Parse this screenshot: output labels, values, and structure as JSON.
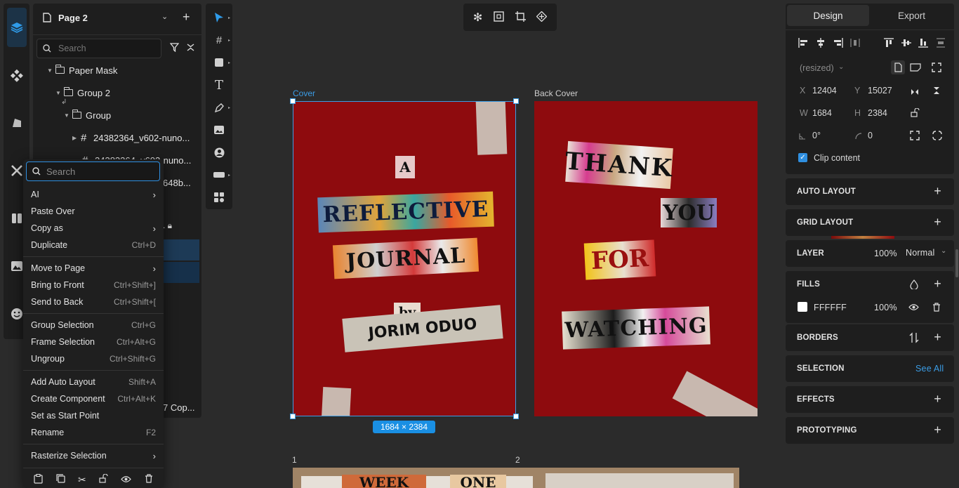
{
  "pages": {
    "current": "Page 2"
  },
  "layers": {
    "search_placeholder": "Search",
    "items": [
      {
        "label": "Paper Mask"
      },
      {
        "label": "Group 2"
      },
      {
        "label": "Group"
      },
      {
        "label": "24382364_v602-nuno..."
      },
      {
        "label": "24382364_v602-nuno..."
      },
      {
        "label": "648b..."
      },
      {
        "label": "7 Cop..."
      }
    ]
  },
  "context_menu": {
    "search_placeholder": "Search",
    "items": [
      {
        "label": "AI",
        "shortcut": "",
        "submenu": true
      },
      {
        "label": "Paste Over",
        "shortcut": ""
      },
      {
        "label": "Copy as",
        "shortcut": "",
        "submenu": true
      },
      {
        "label": "Duplicate",
        "shortcut": "Ctrl+D"
      },
      {
        "label": "Move to Page",
        "shortcut": "",
        "submenu": true
      },
      {
        "label": "Bring to Front",
        "shortcut": "Ctrl+Shift+]"
      },
      {
        "label": "Send to Back",
        "shortcut": "Ctrl+Shift+["
      },
      {
        "label": "Group Selection",
        "shortcut": "Ctrl+G"
      },
      {
        "label": "Frame Selection",
        "shortcut": "Ctrl+Alt+G"
      },
      {
        "label": "Ungroup",
        "shortcut": "Ctrl+Shift+G"
      },
      {
        "label": "Add Auto Layout",
        "shortcut": "Shift+A"
      },
      {
        "label": "Create Component",
        "shortcut": "Ctrl+Alt+K"
      },
      {
        "label": "Set as Start Point",
        "shortcut": ""
      },
      {
        "label": "Rename",
        "shortcut": "F2"
      },
      {
        "label": "Rasterize Selection",
        "shortcut": "",
        "submenu": true
      }
    ]
  },
  "canvas": {
    "frame1_label": "Cover",
    "frame2_label": "Back Cover",
    "size_badge": "1684 × 2384",
    "row2_label1": "1",
    "row2_label2": "2",
    "cover_author": "JORIM ODUO",
    "cover_by": "by",
    "cover_words": [
      "A",
      "REFLECTIVE",
      "JOURNAL"
    ],
    "back_words": [
      "THANK",
      "YOU",
      "FOR",
      "WATCHING"
    ],
    "row2_word1": "WEEK",
    "row2_word2": "ONE",
    "accent": "#1a8fe3",
    "frame_color": "#8e0b0e"
  },
  "design_panel": {
    "tab_design": "Design",
    "tab_export": "Export",
    "resized": "(resized)",
    "x_label": "X",
    "x_value": "12404",
    "y_label": "Y",
    "y_value": "15027",
    "w_label": "W",
    "w_value": "1684",
    "h_label": "H",
    "h_value": "2384",
    "rotation_value": "0°",
    "radius_value": "0",
    "clip_content": "Clip content",
    "sections": {
      "auto_layout": "AUTO LAYOUT",
      "grid_layout": "GRID LAYOUT",
      "layer": "LAYER",
      "layer_opacity": "100%",
      "layer_blend": "Normal",
      "fills": "FILLS",
      "fill_hex": "FFFFFF",
      "fill_opacity": "100%",
      "borders": "BORDERS",
      "selection": "SELECTION",
      "see_all": "See All",
      "effects": "EFFECTS",
      "prototyping": "PROTOTYPING"
    }
  }
}
